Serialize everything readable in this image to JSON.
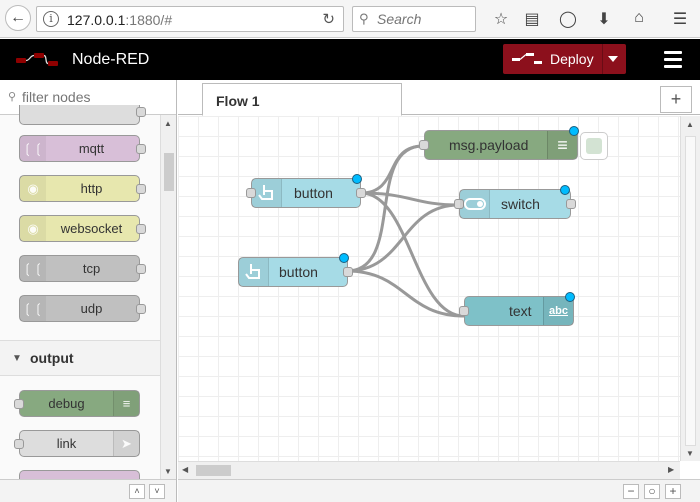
{
  "browser": {
    "url_host": "127.0.0.1",
    "url_rest": ":1880/#",
    "search_placeholder": "Search"
  },
  "header": {
    "title": "Node-RED",
    "deploy_label": "Deploy"
  },
  "palette": {
    "filter_placeholder": "filter nodes",
    "nodes_top": [
      {
        "label": "mqtt",
        "color": "#d8bfd8"
      },
      {
        "label": "http",
        "color": "#e7e7ae"
      },
      {
        "label": "websocket",
        "color": "#e7e7ae"
      },
      {
        "label": "tcp",
        "color": "#c0c0c0"
      },
      {
        "label": "udp",
        "color": "#c0c0c0"
      }
    ],
    "category": "output",
    "nodes_output": [
      {
        "label": "debug",
        "color": "#87a980"
      },
      {
        "label": "link",
        "color": "#dddddd"
      }
    ]
  },
  "workspace": {
    "tab_label": "Flow 1"
  },
  "flow": {
    "nodes": [
      {
        "label": "button",
        "color": "#a6dbe6",
        "icon": "touch-icon"
      },
      {
        "label": "button",
        "color": "#a6dbe6",
        "icon": "touch-icon"
      },
      {
        "label": "msg.payload",
        "color": "#87a980",
        "icon": "debug-list-icon"
      },
      {
        "label": "switch",
        "color": "#a6dbe6",
        "icon": "toggle-icon"
      },
      {
        "label": "text",
        "color": "#7ec1c8",
        "icon": "abc-icon"
      }
    ],
    "text_icon_label": "abc"
  }
}
